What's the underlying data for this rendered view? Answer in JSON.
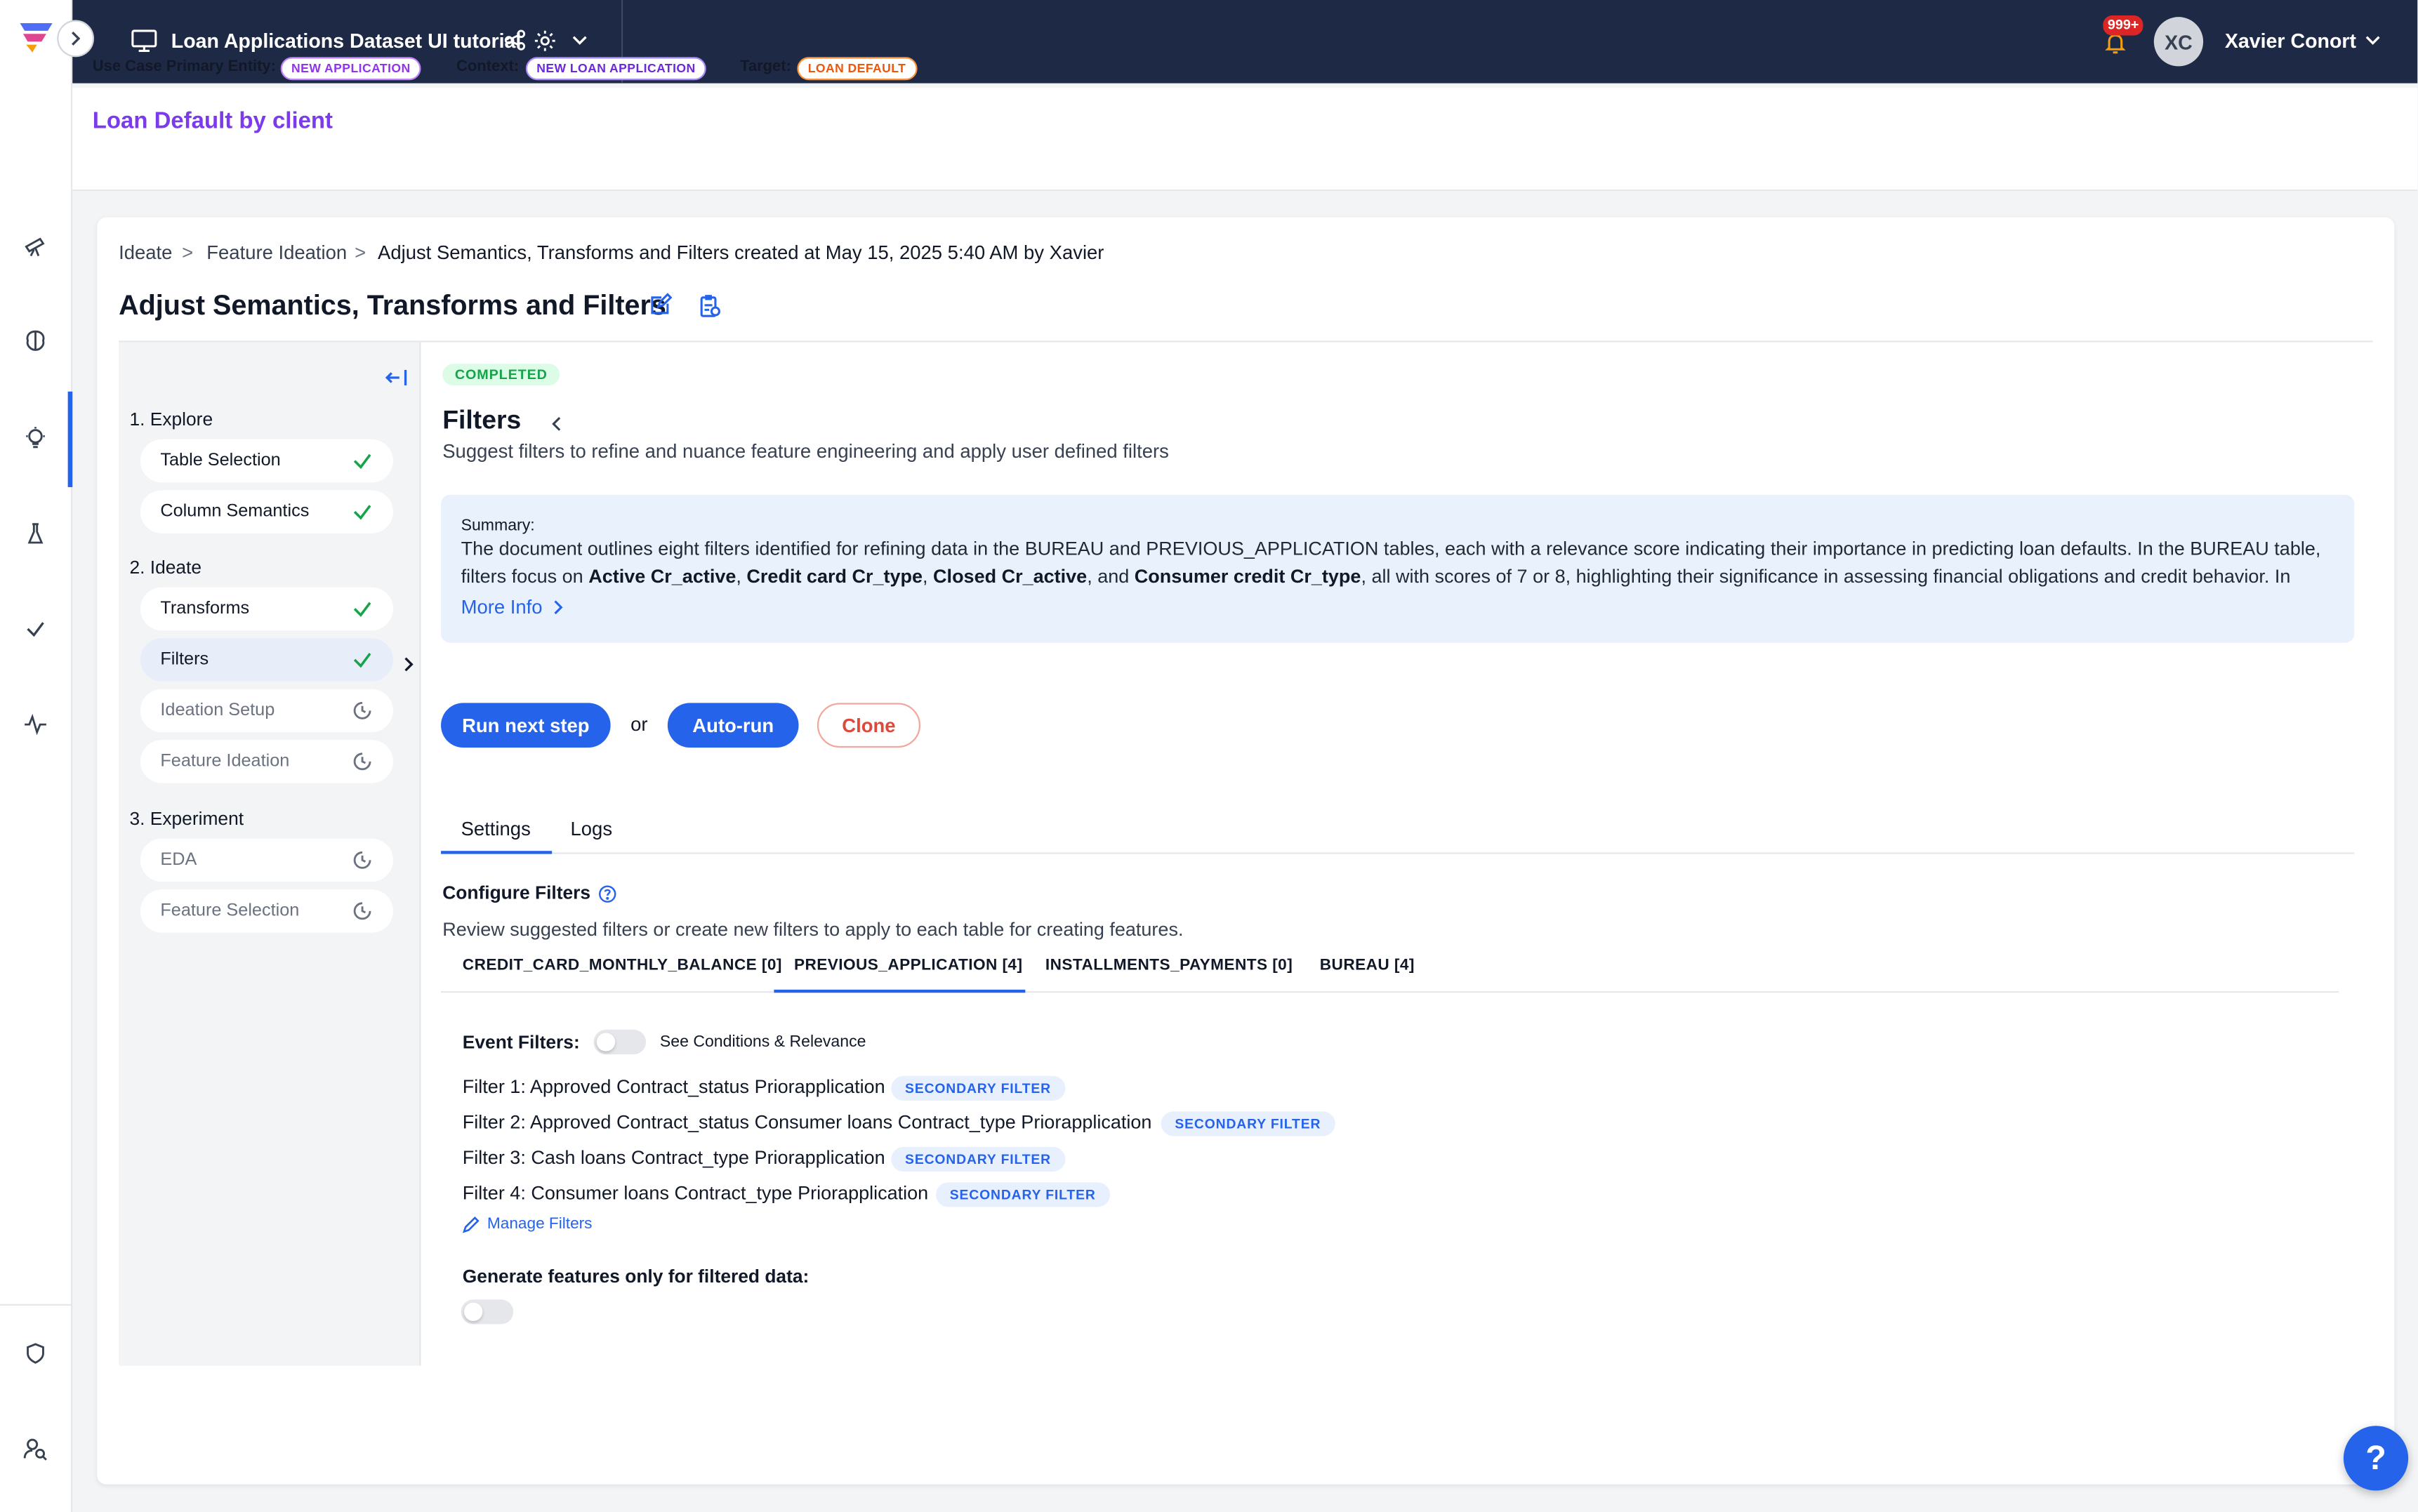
{
  "topbar": {
    "app_title": "Loan Applications Dataset UI tutorial",
    "notification_count": "999+",
    "user_initials": "XC",
    "user_name": "Xavier Conort"
  },
  "use_case": {
    "title": "Loan Default by client",
    "primary_entity_label": "Use Case Primary Entity:",
    "primary_entity_value": "NEW APPLICATION",
    "context_label": "Context:",
    "context_value": "NEW LOAN APPLICATION",
    "target_label": "Target:",
    "target_value": "LOAN DEFAULT"
  },
  "breadcrumb": {
    "items": [
      "Ideate",
      "Feature Ideation",
      "Adjust Semantics, Transforms and Filters created at May 15, 2025 5:40 AM by Xavier"
    ],
    "separator": ">"
  },
  "page": {
    "title": "Adjust Semantics, Transforms and Filters"
  },
  "steps": {
    "groups": [
      {
        "label": "1. Explore",
        "items": [
          {
            "label": "Table Selection",
            "status": "done"
          },
          {
            "label": "Column Semantics",
            "status": "done"
          }
        ]
      },
      {
        "label": "2. Ideate",
        "items": [
          {
            "label": "Transforms",
            "status": "done"
          },
          {
            "label": "Filters",
            "status": "done"
          },
          {
            "label": "Ideation Setup",
            "status": "pending"
          },
          {
            "label": "Feature Ideation",
            "status": "pending"
          }
        ]
      },
      {
        "label": "3. Experiment",
        "items": [
          {
            "label": "EDA",
            "status": "pending"
          },
          {
            "label": "Feature Selection",
            "status": "pending"
          }
        ]
      }
    ]
  },
  "content": {
    "status": "COMPLETED",
    "section_title": "Filters",
    "section_desc": "Suggest filters to refine and nuance feature engineering and apply user defined filters",
    "summary": {
      "label": "Summary:",
      "text_part1": "The document outlines eight filters identified for refining data in the BUREAU and PREVIOUS_APPLICATION tables, each with a relevance score indicating their importance in predicting loan defaults. In the BUREAU table, filters focus on ",
      "bold1": "Active Cr_active",
      "sep1": ", ",
      "bold2": "Credit card Cr_type",
      "sep2": ", ",
      "bold3": "Closed Cr_active",
      "sep3": ", and ",
      "bold4": "Consumer credit Cr_type",
      "text_part2": ", all with scores of 7 or 8, highlighting their significance in assessing financial obligations and credit behavior. In the...",
      "more_info": "More Info"
    },
    "buttons": {
      "run_next": "Run next step",
      "or": "or",
      "auto_run": "Auto-run",
      "clone": "Clone"
    },
    "tabs": [
      "Settings",
      "Logs"
    ],
    "configure": {
      "title": "Configure Filters",
      "desc": "Review suggested filters or create new filters to apply to each table for creating features."
    },
    "table_tabs": [
      "CREDIT_CARD_MONTHLY_BALANCE [0]",
      "PREVIOUS_APPLICATION [4]",
      "INSTALLMENTS_PAYMENTS [0]",
      "BUREAU [4]"
    ],
    "event_filters_label": "Event Filters:",
    "see_conditions_label": "See Conditions & Relevance",
    "filters": [
      {
        "label": "Filter 1: Approved Contract_status Priorapplication",
        "tag": "SECONDARY FILTER"
      },
      {
        "label": "Filter 2: Approved Contract_status Consumer loans Contract_type Priorapplication",
        "tag": "SECONDARY FILTER"
      },
      {
        "label": "Filter 3: Cash loans Contract_type Priorapplication",
        "tag": "SECONDARY FILTER"
      },
      {
        "label": "Filter 4: Consumer loans Contract_type Priorapplication",
        "tag": "SECONDARY FILTER"
      }
    ],
    "manage_filters": "Manage Filters",
    "generate_label": "Generate features only for filtered data:"
  },
  "help_label": "?",
  "colors": {
    "topbar": "#1e2a45",
    "accent": "#2563eb",
    "use_case_title": "#7c3aed",
    "completed": "#16a34a",
    "clone": "#dc4a3c"
  }
}
